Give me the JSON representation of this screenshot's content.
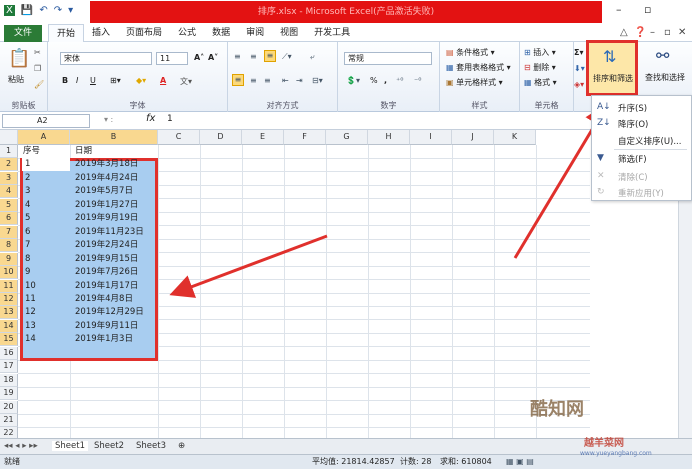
{
  "window": {
    "title": "排序.xlsx - Microsoft Excel(产品激活失败)"
  },
  "quick_access": [
    "💾",
    "↶",
    "↷",
    "▾"
  ],
  "ribbon_tabs": {
    "file": "文件",
    "tabs": [
      "开始",
      "插入",
      "页面布局",
      "公式",
      "数据",
      "审阅",
      "视图",
      "开发工具"
    ]
  },
  "ribbon": {
    "clipboard": {
      "paste": "粘贴",
      "label": "剪贴板"
    },
    "font": {
      "name": "宋体",
      "size": "11",
      "bold": "B",
      "italic": "I",
      "underline": "U",
      "grow": "A˄",
      "shrink": "A˅",
      "color": "A",
      "label": "字体"
    },
    "alignment": {
      "label": "对齐方式"
    },
    "number": {
      "format": "常规",
      "percent": "%",
      "comma": ",",
      "label": "数字"
    },
    "styles": {
      "items": [
        "条件格式",
        "套用表格格式",
        "单元格样式"
      ],
      "label": "样式"
    },
    "cells": {
      "items": [
        "插入",
        "删除",
        "格式"
      ],
      "label": "单元格"
    },
    "editing": {
      "sort_filter": "排序和筛选",
      "find_select": "查找和选择"
    }
  },
  "formula_bar": {
    "name_box": "A2",
    "fx": "fx",
    "value": "1"
  },
  "columns": [
    "A",
    "B",
    "C",
    "D",
    "E",
    "F",
    "G",
    "H",
    "I",
    "J",
    "K"
  ],
  "rows": [
    "1",
    "2",
    "3",
    "4",
    "5",
    "6",
    "7",
    "8",
    "9",
    "10",
    "11",
    "12",
    "13",
    "14",
    "15",
    "16",
    "17",
    "18",
    "19",
    "20",
    "21",
    "22"
  ],
  "table": {
    "headers": [
      "序号",
      "日期"
    ],
    "data": [
      [
        "1",
        "2019年3月18日"
      ],
      [
        "2",
        "2019年4月24日"
      ],
      [
        "3",
        "2019年5月7日"
      ],
      [
        "4",
        "2019年1月27日"
      ],
      [
        "5",
        "2019年9月19日"
      ],
      [
        "6",
        "2019年11月23日"
      ],
      [
        "7",
        "2019年2月24日"
      ],
      [
        "8",
        "2019年9月15日"
      ],
      [
        "9",
        "2019年7月26日"
      ],
      [
        "10",
        "2019年1月17日"
      ],
      [
        "11",
        "2019年4月8日"
      ],
      [
        "12",
        "2019年12月29日"
      ],
      [
        "13",
        "2019年9月11日"
      ],
      [
        "14",
        "2019年1月3日"
      ]
    ]
  },
  "sort_menu": {
    "items": [
      {
        "label": "升序(S)",
        "icon": "A↓",
        "enabled": true
      },
      {
        "label": "降序(O)",
        "icon": "Z↓",
        "enabled": true
      },
      {
        "label": "自定义排序(U)...",
        "icon": "",
        "enabled": true
      },
      {
        "label": "筛选(F)",
        "icon": "▼",
        "enabled": true
      },
      {
        "label": "清除(C)",
        "icon": "✕",
        "enabled": false
      },
      {
        "label": "重新应用(Y)",
        "icon": "↻",
        "enabled": false
      }
    ]
  },
  "sheets": [
    "Sheet1",
    "Sheet2",
    "Sheet3"
  ],
  "status": {
    "ready": "就绪",
    "average": "平均值: 21814.42857",
    "count": "计数: 28",
    "sum": "求和: 610804"
  },
  "watermark": {
    "line1": "酷知网",
    "line2": "越羊菜网",
    "line3": "www.yueyangbang.com"
  },
  "colors": {
    "title_red": "#e31212",
    "file_green": "#2b7b36",
    "highlight_red": "#e0302c",
    "selection_blue": "#a8cdf0",
    "header_sel": "#f9d890"
  }
}
